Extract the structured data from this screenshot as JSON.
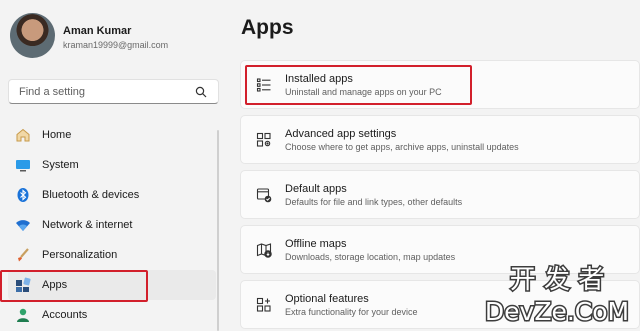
{
  "user": {
    "name": "Aman Kumar",
    "email": "kraman19999@gmail.com"
  },
  "search": {
    "placeholder": "Find a setting"
  },
  "nav": [
    {
      "label": "Home",
      "icon": "home-icon"
    },
    {
      "label": "System",
      "icon": "monitor-icon"
    },
    {
      "label": "Bluetooth & devices",
      "icon": "bluetooth-icon"
    },
    {
      "label": "Network & internet",
      "icon": "wifi-icon"
    },
    {
      "label": "Personalization",
      "icon": "brush-icon"
    },
    {
      "label": "Apps",
      "icon": "apps-icon",
      "selected": true
    },
    {
      "label": "Accounts",
      "icon": "person-icon"
    }
  ],
  "page": {
    "title": "Apps"
  },
  "cards": [
    {
      "title": "Installed apps",
      "desc": "Uninstall and manage apps on your PC",
      "icon": "list-icon"
    },
    {
      "title": "Advanced app settings",
      "desc": "Choose where to get apps, archive apps, uninstall updates",
      "icon": "app-settings-icon"
    },
    {
      "title": "Default apps",
      "desc": "Defaults for file and link types, other defaults",
      "icon": "default-apps-icon"
    },
    {
      "title": "Offline maps",
      "desc": "Downloads, storage location, map updates",
      "icon": "map-icon"
    },
    {
      "title": "Optional features",
      "desc": "Extra functionality for your device",
      "icon": "optional-features-icon"
    }
  ],
  "watermark": {
    "line1": "开 发 者",
    "line2": "DevZe.CoM"
  },
  "colors": {
    "highlight": "#d21f2b",
    "accent": "#0067c0",
    "background": "#f3f3f3",
    "card": "#fbfbfb"
  }
}
